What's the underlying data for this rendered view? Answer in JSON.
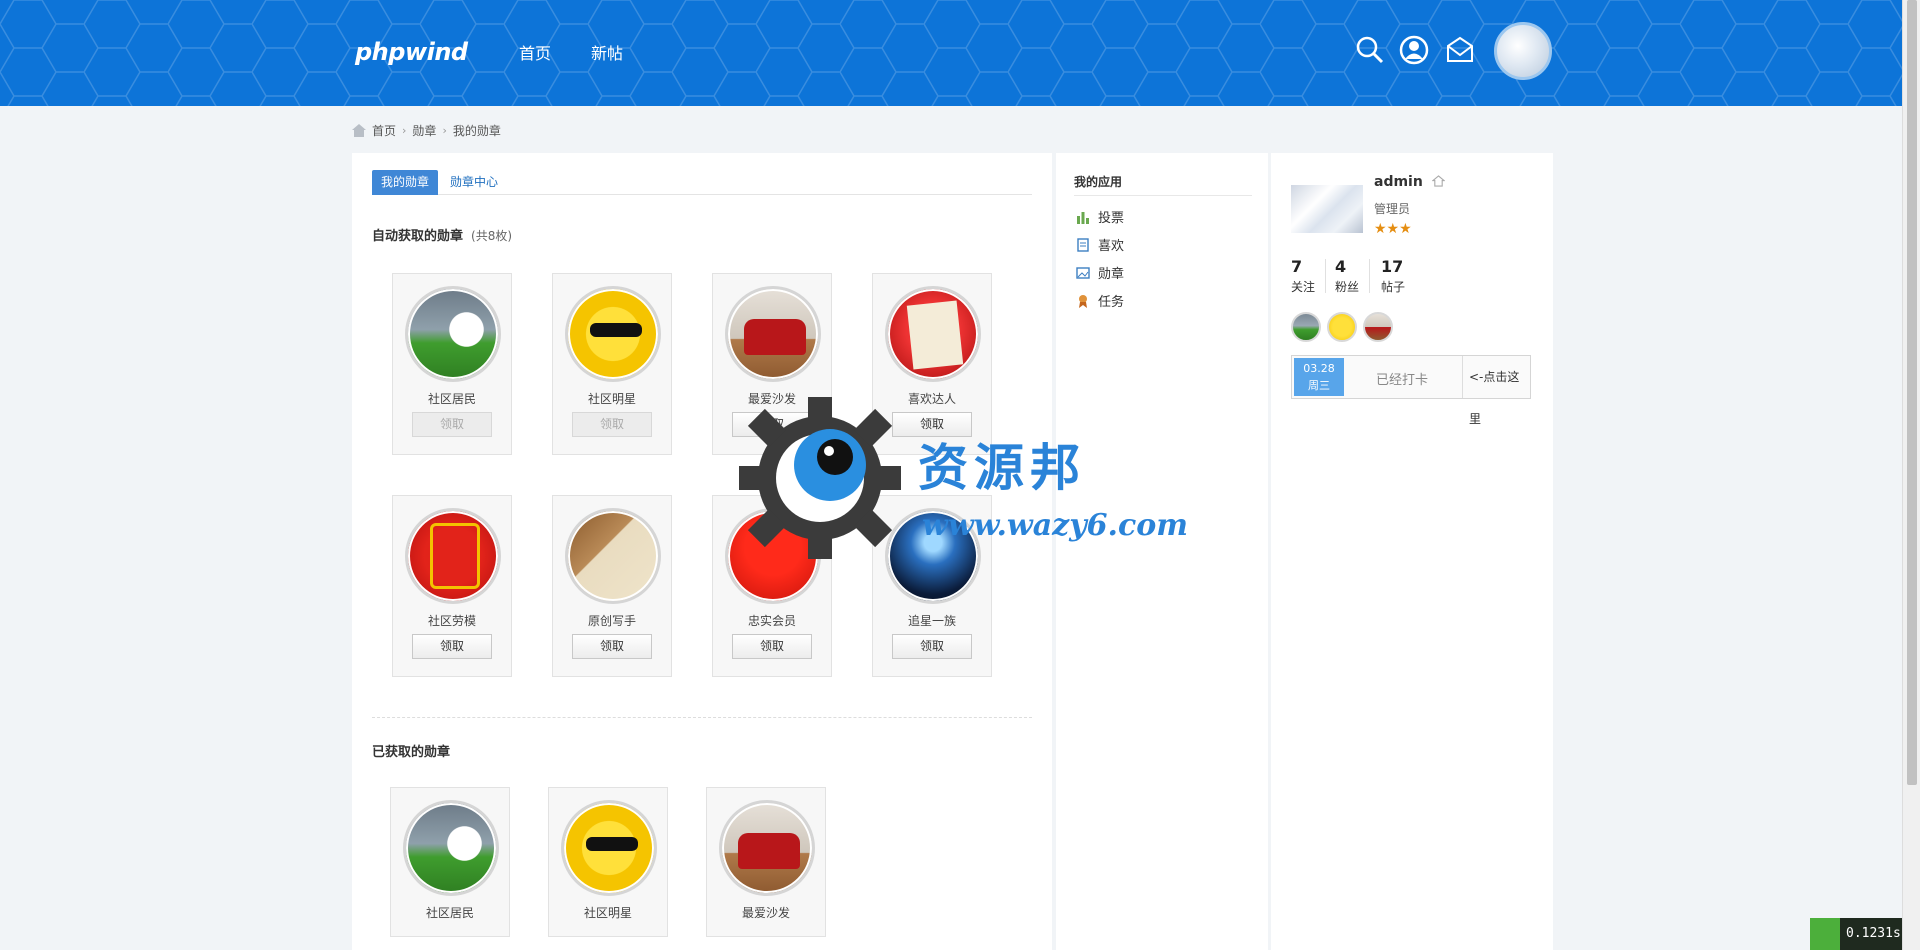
{
  "header": {
    "logo": "phpwind",
    "nav": [
      "首页",
      "新帖"
    ],
    "icons": [
      "search-icon",
      "user-icon",
      "mail-icon"
    ]
  },
  "breadcrumb": [
    "首页",
    "勋章",
    "我的勋章"
  ],
  "tabs": {
    "active": "我的勋章",
    "other": "勋章中心"
  },
  "auto_section": {
    "title": "自动获取的勋章",
    "count": "(共8枚)"
  },
  "auto_medals": [
    {
      "name": "社区居民",
      "button": "领取",
      "disabled": true
    },
    {
      "name": "社区明星",
      "button": "领取",
      "disabled": true
    },
    {
      "name": "最爱沙发",
      "button": "领取",
      "disabled": false
    },
    {
      "name": "喜欢达人",
      "button": "领取",
      "disabled": false
    },
    {
      "name": "社区劳模",
      "button": "领取",
      "disabled": false
    },
    {
      "name": "原创写手",
      "button": "领取",
      "disabled": false
    },
    {
      "name": "忠实会员",
      "button": "领取",
      "disabled": false
    },
    {
      "name": "追星一族",
      "button": "领取",
      "disabled": false
    }
  ],
  "owned_section": {
    "title": "已获取的勋章"
  },
  "owned_medals": [
    {
      "name": "社区居民"
    },
    {
      "name": "社区明星"
    },
    {
      "name": "最爱沙发"
    }
  ],
  "apps": {
    "title": "我的应用",
    "items": [
      "投票",
      "喜欢",
      "勋章",
      "任务"
    ]
  },
  "user": {
    "name": "admin",
    "role": "管理员",
    "stars": "★★★",
    "stats": [
      {
        "num": "7",
        "label": "关注"
      },
      {
        "num": "4",
        "label": "粉丝"
      },
      {
        "num": "17",
        "label": "帖子"
      }
    ],
    "checkin": {
      "date": "03.28",
      "weekday": "周三",
      "status": "已经打卡",
      "hint": "<-点击这里"
    }
  },
  "watermark": {
    "title": "资源邦",
    "url": "www.wazy6.com"
  },
  "timer": "0.1231s",
  "colors": {
    "header": "#0d74d8",
    "accent": "#3f87d6",
    "star": "#e58e12"
  }
}
